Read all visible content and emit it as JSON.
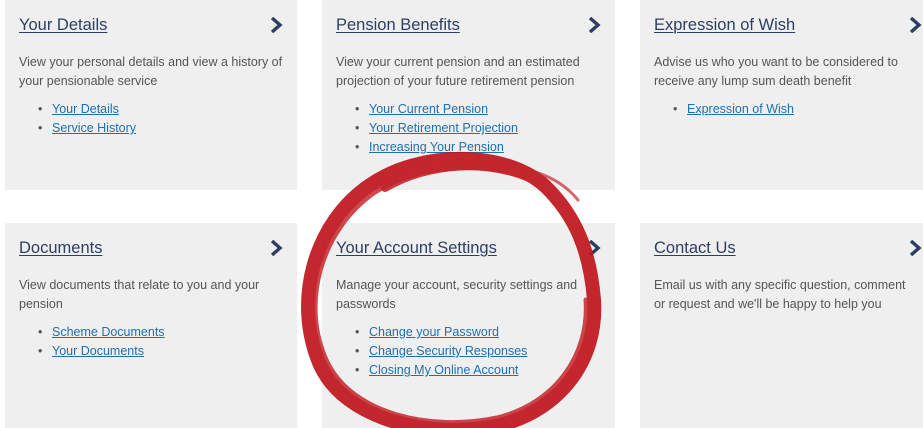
{
  "cards": [
    {
      "title": "Your Details",
      "description": "View your personal details and view a history of your pensionable service",
      "links": [
        "Your Details",
        "Service History"
      ]
    },
    {
      "title": "Pension Benefits",
      "description": "View your current pension and an estimated projection of your future retirement pension",
      "links": [
        "Your Current Pension",
        "Your Retirement Projection",
        "Increasing Your Pension"
      ]
    },
    {
      "title": "Expression of Wish",
      "description": "Advise us who you want to be considered to receive any lump sum death benefit",
      "links": [
        "Expression of Wish"
      ]
    },
    {
      "title": "Documents",
      "description": "View documents that relate to you and your pension",
      "links": [
        "Scheme Documents",
        "Your Documents"
      ]
    },
    {
      "title": "Your Account Settings",
      "description": "Manage your account, security settings and passwords",
      "links": [
        "Change your Password",
        "Change Security Responses",
        "Closing My Online Account"
      ]
    },
    {
      "title": "Contact Us",
      "description": "Email us with any specific question, comment or request and we'll be happy to help you",
      "links": []
    }
  ],
  "icons": {
    "chevron": "chevron-right-icon",
    "highlight": "red-brush-circle"
  },
  "colors": {
    "card_background": "#efefef",
    "title": "#2b3f63",
    "link": "#1f6fb2",
    "text": "#555555",
    "highlight": "#c0151c"
  }
}
